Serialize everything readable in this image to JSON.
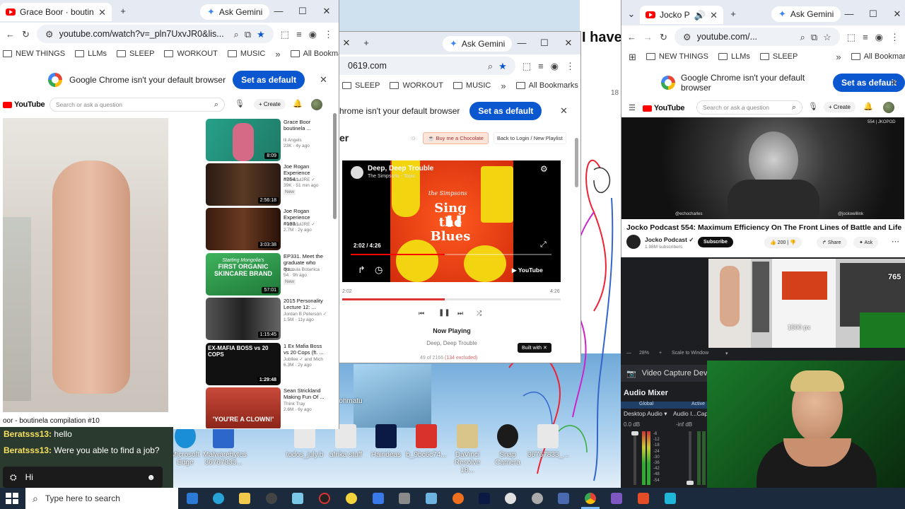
{
  "window_left": {
    "tab_title": "Grace Boor · boutinela compilatio",
    "ask_gemini": "Ask Gemini",
    "url": "youtube.com/watch?v=_pln7UxvJR0&lis...",
    "bookmarks": [
      "NEW THINGS",
      "LLMs",
      "SLEEP",
      "WORKOUT",
      "MUSIC"
    ],
    "all_bookmarks": "All Bookmarks",
    "banner_text": "Google Chrome isn't your default browser",
    "set_default": "Set as default",
    "yt_logo": "YouTube",
    "search_placeholder": "Search or ask a question",
    "create": "Create",
    "video_caption": "oor - boutinela compilation #10",
    "recommendations": [
      {
        "title": "Grace Boor boutinela ...",
        "channel": "lil Angels",
        "meta": "23K · 4y ago",
        "badge": "",
        "duration": "8:09",
        "color": "#1e8b76"
      },
      {
        "title": "Joe Rogan Experience #254...",
        "channel": "PowerfulJRE ✓",
        "meta": "39K · 51 min ago",
        "badge": "New",
        "duration": "2:56:18",
        "color": "#3a2418"
      },
      {
        "title": "Joe Rogan Experience #193...",
        "channel": "PowerfulJRE ✓",
        "meta": "2.7M · 2y ago",
        "badge": "",
        "duration": "3:03:38",
        "color": "#3b1f14"
      },
      {
        "title": "EP331. Meet the graduate who qu...",
        "channel": "Formula Botanica",
        "meta": "54 · 9h ago",
        "badge": "New",
        "duration": "57:01",
        "color": "#2f9a4a"
      },
      {
        "title": "2015 Personality Lecture 12: ...",
        "channel": "Jordan B Peterson ✓",
        "meta": "1.5M · 11y ago",
        "badge": "",
        "duration": "1:15:45",
        "color": "#3b3b3b"
      },
      {
        "title": "1 Ex Mafia Boss vs 20 Cops (ft. ...",
        "channel": "Jubilee ✓ and Mich",
        "meta": "6.3M · 2y ago",
        "badge": "",
        "duration": "1:29:48",
        "color": "#111111"
      },
      {
        "title": "Sean Strickland Making Fun Of ...",
        "channel": "Think Tray",
        "meta": "2.6M · 6y ago",
        "badge": "",
        "duration": "",
        "color": "#b7322a"
      }
    ],
    "thumb_texts": {
      "gemini": "Starting Mongolia's",
      "first_organic": "FIRST ORGANIC",
      "skincare": "SKINCARE BRAND",
      "mafia": "EX-MAFIA BOSS vs 20 COPS",
      "clown": "'YOU'RE A CLOWN!'"
    }
  },
  "window_mid": {
    "url": "0619.com",
    "ask_gemini": "Ask Gemini",
    "bookmarks": [
      "SLEEP",
      "WORKOUT",
      "MUSIC"
    ],
    "all_bookmarks": "All Bookmarks",
    "banner_text": "hrome isn't your default browser",
    "set_default": "Set as default",
    "heading_fragment": "er",
    "buy_chocolate": "Buy me a Chocolate",
    "back_login": "Back to Login / New Playlist",
    "embed_title": "Deep, Deep Trouble",
    "embed_channel": "The Simpsons - Topic",
    "art_brand": "the Simpsons",
    "art_title": "Sing the Blues",
    "embed_time": "2:02 / 4:26",
    "youtube_badge": "YouTube",
    "time_current": "2:02",
    "time_total": "4:26",
    "progress": 0.47,
    "now_playing_label": "Now Playing",
    "now_playing_track": "Deep, Deep Trouble",
    "count_text": "49 of 2166",
    "excluded_text": "(134 excluded)",
    "built_with": "Built with"
  },
  "window_right": {
    "tab_title": "Jocko Podcast",
    "ask_gemini": "Ask Gemini",
    "url": "youtube.com/...",
    "bookmarks": [
      "NEW THINGS",
      "LLMs",
      "SLEEP"
    ],
    "all_bookmarks": "All Bookmarks",
    "banner_text": "Google Chrome isn't your default browser",
    "set_default": "Set as default",
    "yt_logo": "YouTube",
    "search_placeholder": "Search or ask a question",
    "create": "Create",
    "video_corner": "554 | JKOPOD",
    "handle_left": "@echocharles",
    "handle_right": "@jockowillink",
    "video_title": "Jocko Podcast 554: Maximum Efficiency On The Front Lines of Battle and Life",
    "channel": "Jocko Podcast ✓",
    "subscribers": "1.98M subscribers",
    "subscribe": "Subscribe",
    "likes": "200",
    "share": "Share",
    "ask": "Ask"
  },
  "background": {
    "text_fragment": "I have",
    "scale_number": "18"
  },
  "obs": {
    "zoom": "28%",
    "scale_label": "Scale to Window",
    "px_overlay": "1500 px",
    "side_number": "765",
    "video_capture": "Video Capture Device",
    "audio_mixer": "Audio Mixer",
    "global": "Global",
    "active": "Active",
    "desktop_audio": "Desktop Audio",
    "audio_capture": "Audio I...Cap",
    "db_left": "0.0 dB",
    "db_right": "-inf dB",
    "scale_marks": [
      "-6",
      "-12",
      "-18",
      "-24",
      "-30",
      "-36",
      "-42",
      "-48",
      "-54"
    ]
  },
  "chat": {
    "messages": [
      {
        "user": "Beratsss13:",
        "text": "hello"
      },
      {
        "user": "Beratsss13:",
        "text": "Were you able to find a job?"
      }
    ],
    "input_value": "Hi"
  },
  "desktop_icons": [
    {
      "label": "Microsoft Edge",
      "color": "#1a8fd8"
    },
    {
      "label": "Malwarebytes 36767833...",
      "color": "#2d67c9"
    },
    {
      "label": "todos_july.b",
      "color": "#e8e8e8"
    },
    {
      "label": "afrika stuff",
      "color": "#e8e8e8"
    },
    {
      "label": "Hairideas",
      "color": "#0a1a44"
    },
    {
      "label": "b_9bc6c74...",
      "color": "#d8322a"
    },
    {
      "label": "DaVinci Resolve 18...",
      "color": "#d9c58a"
    },
    {
      "label": "Snap Camera",
      "color": "#1b1b1b"
    },
    {
      "label": "36767833_...",
      "color": "#e8e8e8"
    }
  ],
  "desk_misc": {
    "partial_label": "ohmatu"
  },
  "taskbar": {
    "search_placeholder": "Type here to search"
  }
}
